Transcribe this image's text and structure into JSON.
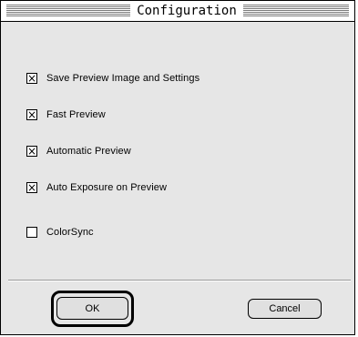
{
  "window": {
    "title": "Configuration"
  },
  "options": [
    {
      "label": "Save Preview Image and Settings",
      "checked": true,
      "mark": "×"
    },
    {
      "label": "Fast Preview",
      "checked": true,
      "mark": "×"
    },
    {
      "label": "Automatic Preview",
      "checked": true,
      "mark": "×"
    },
    {
      "label": "Auto Exposure on Preview",
      "checked": true,
      "mark": "×"
    },
    {
      "label": "ColorSync",
      "checked": false,
      "mark": ""
    }
  ],
  "buttons": {
    "ok_label": "OK",
    "cancel_label": "Cancel"
  }
}
